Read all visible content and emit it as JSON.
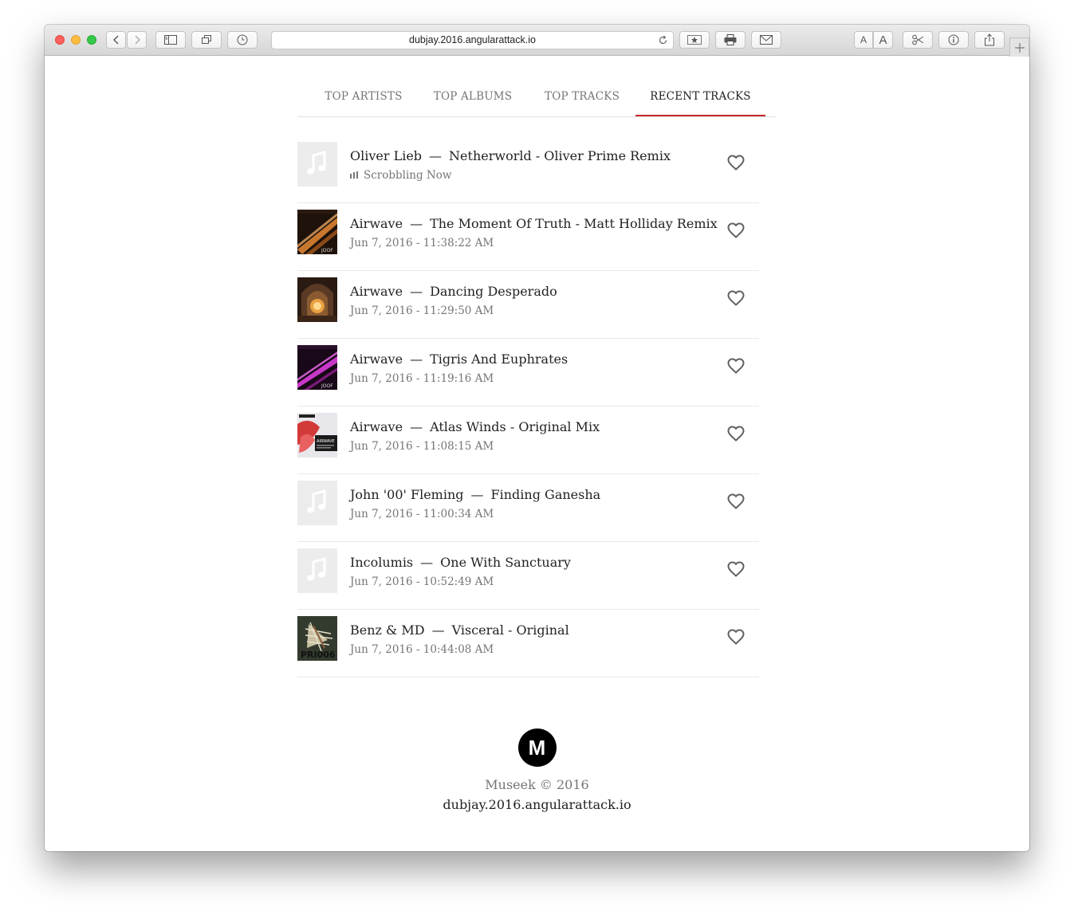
{
  "browser": {
    "url": "dubjay.2016.angularattack.io"
  },
  "tabs": [
    {
      "label": "TOP ARTISTS",
      "active": false
    },
    {
      "label": "TOP ALBUMS",
      "active": false
    },
    {
      "label": "TOP TRACKS",
      "active": false
    },
    {
      "label": "RECENT TRACKS",
      "active": true
    }
  ],
  "tracks": [
    {
      "artist": "Oliver Lieb",
      "title": "Netherworld - Oliver Prime Remix",
      "time": "Scrobbling Now",
      "art": "placeholder",
      "now_playing": true
    },
    {
      "artist": "Airwave",
      "title": "The Moment Of Truth - Matt Holliday Remix",
      "time": "Jun 7, 2016 - 11:38:22 AM",
      "art": "orange-streak"
    },
    {
      "artist": "Airwave",
      "title": "Dancing Desperado",
      "time": "Jun 7, 2016 - 11:29:50 AM",
      "art": "cathedral"
    },
    {
      "artist": "Airwave",
      "title": "Tigris And Euphrates",
      "time": "Jun 7, 2016 - 11:19:16 AM",
      "art": "purple-streak"
    },
    {
      "artist": "Airwave",
      "title": "Atlas Winds - Original Mix",
      "time": "Jun 7, 2016 - 11:08:15 AM",
      "art": "red-abstract"
    },
    {
      "artist": "John '00' Fleming",
      "title": "Finding Ganesha",
      "time": "Jun 7, 2016 - 11:00:34 AM",
      "art": "placeholder"
    },
    {
      "artist": "Incolumis",
      "title": "One With Sanctuary",
      "time": "Jun 7, 2016 - 10:52:49 AM",
      "art": "placeholder"
    },
    {
      "artist": "Benz & MD",
      "title": "Visceral - Original",
      "time": "Jun 7, 2016 - 10:44:08 AM",
      "art": "lionfish"
    }
  ],
  "footer": {
    "logo_letter": "M",
    "copyright": "Museek © 2016",
    "domain": "dubjay.2016.angularattack.io"
  },
  "colors": {
    "accent": "#c62828",
    "text": "#222222",
    "muted": "#757575"
  }
}
